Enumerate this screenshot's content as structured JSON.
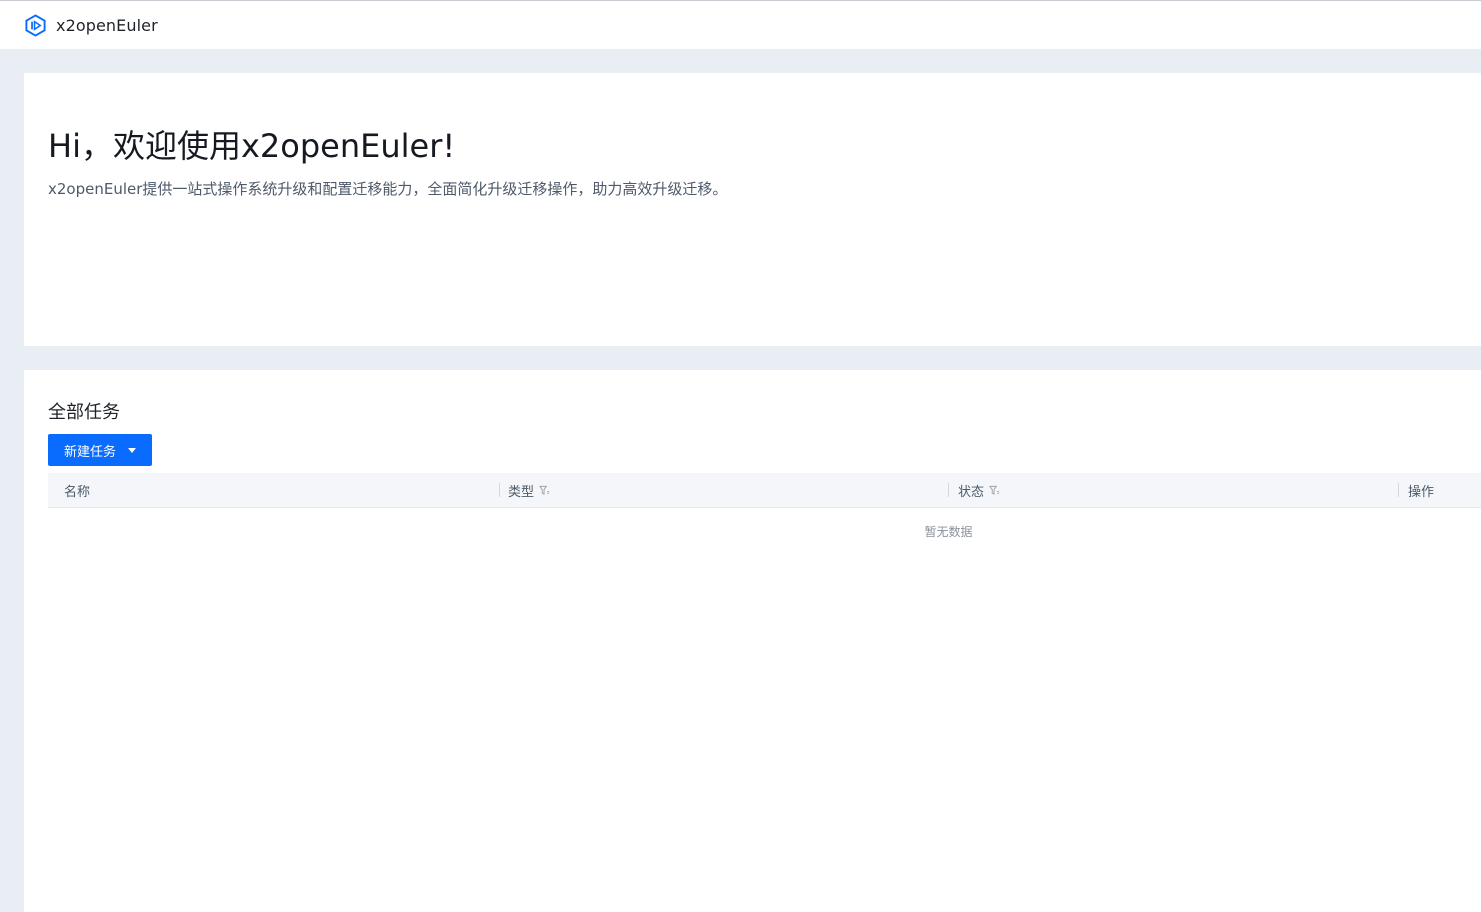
{
  "header": {
    "app_title": "x2openEuler",
    "logo_icon": "hexagon-logo-icon"
  },
  "welcome": {
    "title": "Hi，欢迎使用x2openEuler!",
    "subtitle": "x2openEuler提供一站式操作系统升级和配置迁移能力，全面简化升级迁移操作，助力高效升级迁移。"
  },
  "tasks": {
    "title": "全部任务",
    "new_task_label": "新建任务",
    "columns": {
      "name": "名称",
      "type": "类型",
      "status": "状态",
      "action": "操作"
    },
    "empty_text": "暂无数据"
  },
  "colors": {
    "primary": "#0a6cff",
    "page_bg": "#e9eef5",
    "table_header_bg": "#f4f6f9"
  }
}
